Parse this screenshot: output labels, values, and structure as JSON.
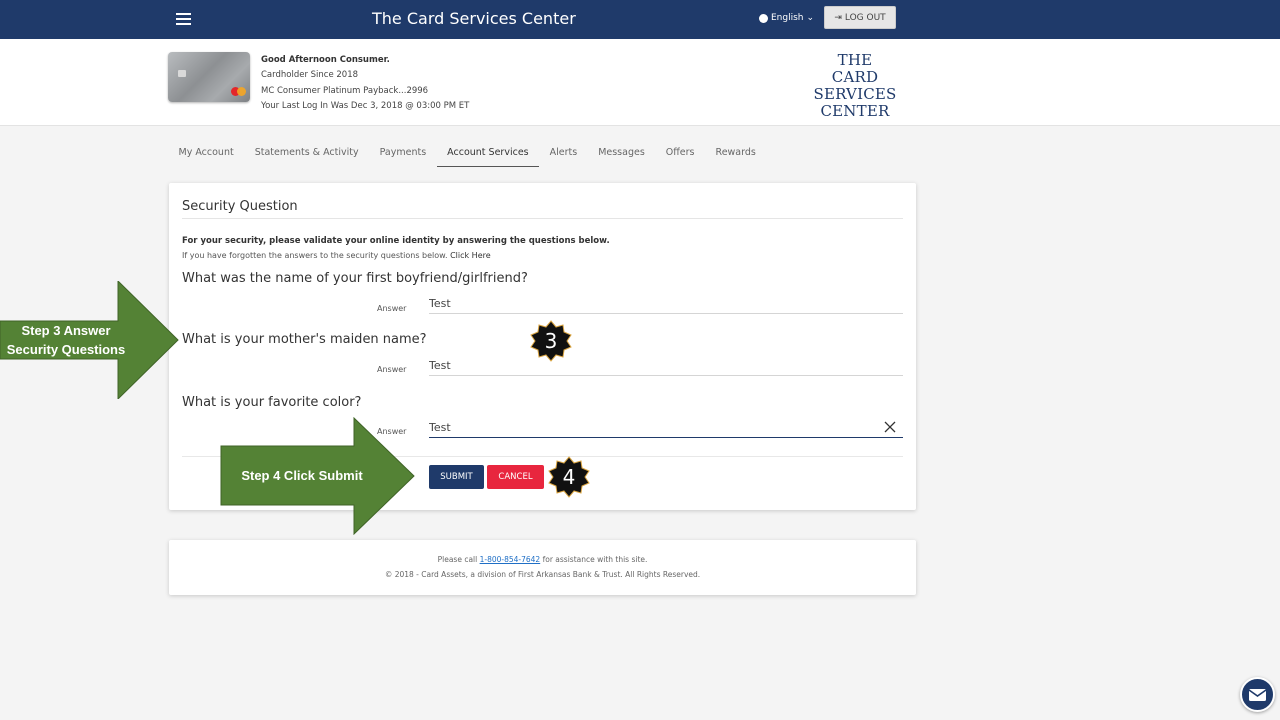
{
  "header": {
    "title": "The Card Services Center",
    "language": "English",
    "logout_label": "LOG OUT"
  },
  "account": {
    "greeting": "Good Afternoon Consumer.",
    "since": "Cardholder Since 2018",
    "card_name": "MC Consumer Platinum Payback...2996",
    "last_login": "Your Last Log In Was Dec 3, 2018 @ 03:00 PM ET",
    "logo_lines": [
      "THE",
      "CARD SERVICES",
      "CENTER"
    ]
  },
  "nav": {
    "tabs": [
      "My Account",
      "Statements & Activity",
      "Payments",
      "Account Services",
      "Alerts",
      "Messages",
      "Offers",
      "Rewards"
    ],
    "active": "Account Services"
  },
  "security": {
    "title": "Security Question",
    "intro_bold": "For your security, please validate your online identity by answering the questions below.",
    "intro_small": "If you have forgotten the answers to the security questions below.",
    "click_here": "Click Here",
    "answer_label": "Answer",
    "questions": [
      {
        "text": "What was the name of your first boyfriend/girlfriend?",
        "answer": "Test"
      },
      {
        "text": "What is your mother's maiden name?",
        "answer": "Test"
      },
      {
        "text": "What is your favorite color?",
        "answer": "Test"
      }
    ],
    "submit_label": "SUBMIT",
    "cancel_label": "CANCEL"
  },
  "footer": {
    "call_prefix": "Please call",
    "phone": "1-800-854-7642",
    "call_suffix": "for assistance with this site.",
    "copyright": "© 2018 - Card Assets, a division of First Arkansas Bank & Trust. All Rights Reserved."
  },
  "annotations": {
    "step3": [
      "Step 3 Answer",
      "Security Questions"
    ],
    "step4": "Step 4 Click Submit",
    "badge3": "3",
    "badge4": "4",
    "arrow_color": "#548235"
  },
  "colors": {
    "navy": "#1f3a6a",
    "cancel_red": "#e8263e",
    "arrow_green": "#548235"
  }
}
